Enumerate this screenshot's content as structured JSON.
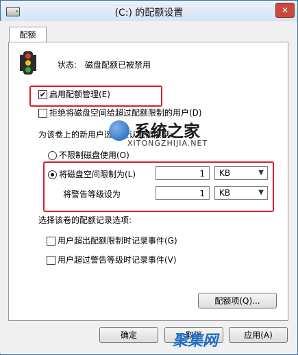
{
  "window": {
    "title": "(C:) 的配额设置",
    "close": "✕"
  },
  "tabs": [
    {
      "label": "配额"
    }
  ],
  "status": {
    "label": "状态:",
    "value": "磁盘配额已被禁用"
  },
  "options": {
    "enable_quota": {
      "label": "启用配额管理(E)",
      "checked": true
    },
    "deny_space": {
      "label": "拒绝将磁盘空间给超过配额限制的用户(D)",
      "checked": false
    }
  },
  "default_section": {
    "heading": "为该卷上的新用户选择默认配额限制:",
    "no_limit": {
      "label": "不限制磁盘使用(O)",
      "selected": false
    },
    "limit": {
      "label": "将磁盘空间限制为(L)",
      "selected": true,
      "value": "1",
      "unit": "KB"
    },
    "warning": {
      "label": "将警告等级设为",
      "value": "1",
      "unit": "KB"
    }
  },
  "log_section": {
    "heading": "选择该卷的配额记录选项:",
    "over_limit": {
      "label": "用户超出配额限制时记录事件(G)",
      "checked": false
    },
    "over_warning": {
      "label": "用户超过警告等级时记录事件(V)",
      "checked": false
    }
  },
  "buttons": {
    "entries": "配额项(Q)...",
    "ok": "确定",
    "cancel": "取消",
    "apply": "应用(A)"
  },
  "watermark": {
    "title": "系统之家",
    "url": "XITONGZHIJIA.NET",
    "bottom": "聚集网"
  },
  "colors": {
    "highlight": "#d6202a",
    "title_bar": "#d5e4f4"
  }
}
